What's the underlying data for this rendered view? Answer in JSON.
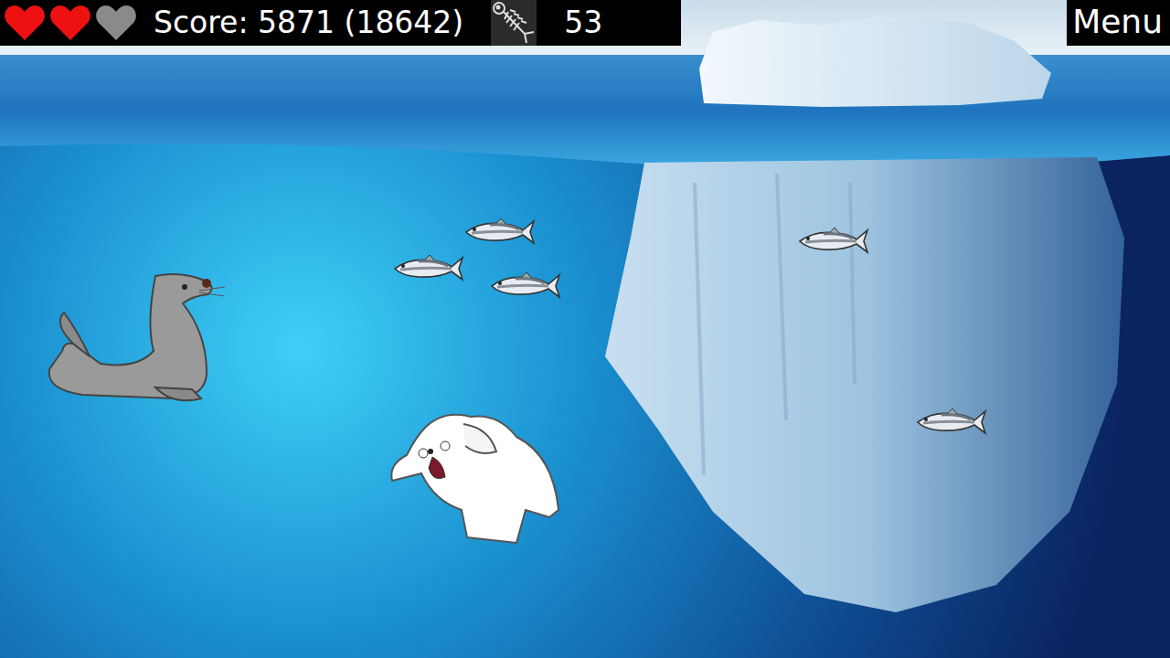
{
  "hud": {
    "hearts": [
      {
        "filled": true
      },
      {
        "filled": true
      },
      {
        "filled": false
      }
    ],
    "score": "Score: 5871 (18642)",
    "fish_count": "53"
  },
  "menu": {
    "label": "Menu"
  },
  "scene": {
    "entities": [
      {
        "kind": "seal"
      },
      {
        "kind": "bear"
      },
      {
        "kind": "fish"
      },
      {
        "kind": "fish"
      },
      {
        "kind": "fish"
      },
      {
        "kind": "fish"
      },
      {
        "kind": "fish"
      }
    ]
  }
}
